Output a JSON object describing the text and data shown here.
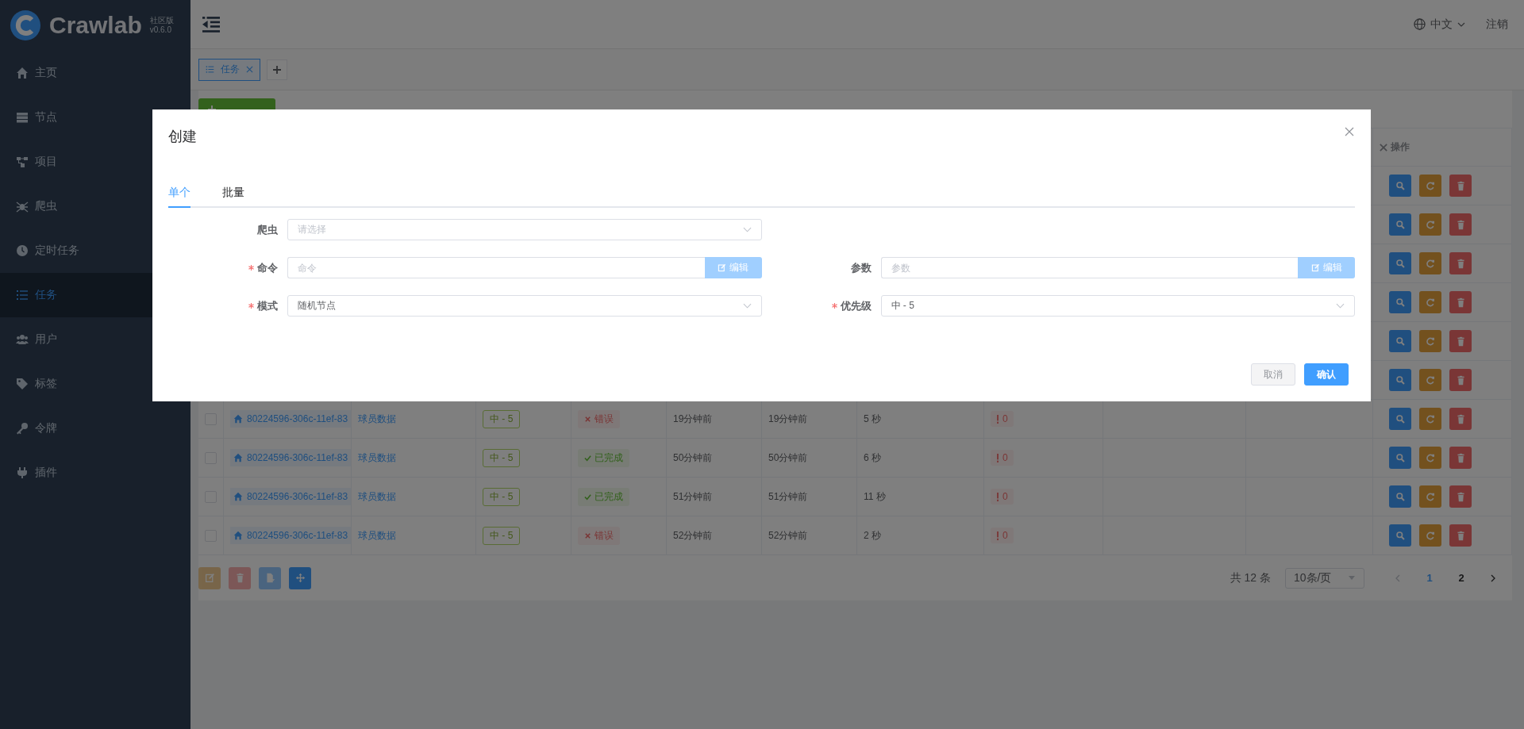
{
  "sidebar": {
    "logo": {
      "name": "Crawlab",
      "edition": "社区版",
      "version": "v0.6.0"
    },
    "items": [
      {
        "label": "主页",
        "kind": "home",
        "selected": false
      },
      {
        "label": "节点",
        "kind": "stack",
        "selected": false
      },
      {
        "label": "项目",
        "kind": "hierarchy",
        "selected": false
      },
      {
        "label": "爬虫",
        "kind": "spider",
        "selected": false
      },
      {
        "label": "定时任务",
        "kind": "clock",
        "selected": false
      },
      {
        "label": "任务",
        "kind": "list",
        "selected": true
      },
      {
        "label": "用户",
        "kind": "users",
        "selected": false
      },
      {
        "label": "标签",
        "kind": "tag",
        "selected": false
      },
      {
        "label": "令牌",
        "kind": "key",
        "selected": false
      },
      {
        "label": "插件",
        "kind": "plug",
        "selected": false
      }
    ]
  },
  "header": {
    "language": "中文",
    "logout": "注销"
  },
  "page_tabs": [
    {
      "label": "任务",
      "selected": true
    }
  ],
  "toolbar": {
    "new_button": true
  },
  "table": {
    "action_header": "操作",
    "rows": [
      {
        "actions": [
          {
            "kind": "view"
          },
          {
            "kind": "restart"
          },
          {
            "kind": "delete"
          }
        ]
      },
      {
        "actions": [
          {
            "kind": "view"
          },
          {
            "kind": "restart"
          },
          {
            "kind": "delete"
          }
        ]
      },
      {
        "actions": [
          {
            "kind": "view"
          },
          {
            "kind": "restart"
          },
          {
            "kind": "delete"
          }
        ]
      },
      {
        "actions": [
          {
            "kind": "view"
          },
          {
            "kind": "restart"
          },
          {
            "kind": "delete"
          }
        ]
      },
      {
        "actions": [
          {
            "kind": "view"
          },
          {
            "kind": "restart"
          },
          {
            "kind": "delete"
          }
        ]
      },
      {
        "actions": [
          {
            "kind": "view"
          },
          {
            "kind": "restart"
          },
          {
            "kind": "delete"
          }
        ]
      },
      {
        "checked": false,
        "task_id": "80224596-306c-11ef-83",
        "spider": "球员数据",
        "priority": "中 - 5",
        "status": {
          "kind": "error",
          "label": "错误"
        },
        "started": "19分钟前",
        "finished": "19分钟前",
        "duration": "5 秒",
        "errors": "0",
        "actions": [
          {
            "kind": "view"
          },
          {
            "kind": "restart"
          },
          {
            "kind": "delete"
          }
        ]
      },
      {
        "checked": false,
        "task_id": "80224596-306c-11ef-83",
        "spider": "球员数据",
        "priority": "中 - 5",
        "status": {
          "kind": "finished",
          "label": "已完成"
        },
        "started": "50分钟前",
        "finished": "50分钟前",
        "duration": "6 秒",
        "errors": "0",
        "actions": [
          {
            "kind": "view"
          },
          {
            "kind": "restart"
          },
          {
            "kind": "delete"
          }
        ]
      },
      {
        "checked": false,
        "task_id": "80224596-306c-11ef-83",
        "spider": "球员数据",
        "priority": "中 - 5",
        "status": {
          "kind": "finished",
          "label": "已完成"
        },
        "started": "51分钟前",
        "finished": "51分钟前",
        "duration": "11 秒",
        "errors": "0",
        "actions": [
          {
            "kind": "view"
          },
          {
            "kind": "restart"
          },
          {
            "kind": "delete"
          }
        ]
      },
      {
        "checked": false,
        "task_id": "80224596-306c-11ef-83",
        "spider": "球员数据",
        "priority": "中 - 5",
        "status": {
          "kind": "error",
          "label": "错误"
        },
        "started": "52分钟前",
        "finished": "52分钟前",
        "duration": "2 秒",
        "errors": "0",
        "actions": [
          {
            "kind": "view"
          },
          {
            "kind": "restart"
          },
          {
            "kind": "delete"
          }
        ]
      }
    ]
  },
  "bulk_actions": [
    {
      "kind": "edit",
      "disabled": true
    },
    {
      "kind": "delete",
      "disabled": true
    },
    {
      "kind": "export",
      "disabled": true
    },
    {
      "kind": "move",
      "disabled": false
    }
  ],
  "pagination": {
    "total": "共 12 条",
    "page_size": "10条/页",
    "pages": [
      {
        "label": "1",
        "selected": true
      },
      {
        "label": "2",
        "selected": false
      }
    ]
  },
  "dialog": {
    "title": "创建",
    "tabs": [
      {
        "label": "单个",
        "selected": true
      },
      {
        "label": "批量",
        "selected": false
      }
    ],
    "form_rows": [
      [
        {
          "label": "爬虫",
          "required": false,
          "kind": "select",
          "placeholder": "请选择"
        }
      ],
      [
        {
          "label": "命令",
          "required": true,
          "kind": "editor",
          "placeholder": "命令",
          "button": "编辑"
        },
        {
          "label": "参数",
          "required": false,
          "kind": "editor",
          "placeholder": "参数",
          "button": "编辑"
        }
      ],
      [
        {
          "label": "模式",
          "required": true,
          "kind": "select",
          "value": "随机节点"
        },
        {
          "label": "优先级",
          "required": true,
          "kind": "select",
          "value": "中 - 5"
        }
      ]
    ],
    "buttons": [
      {
        "label": "取消",
        "kind": "default"
      },
      {
        "label": "确认",
        "kind": "primary"
      }
    ]
  }
}
